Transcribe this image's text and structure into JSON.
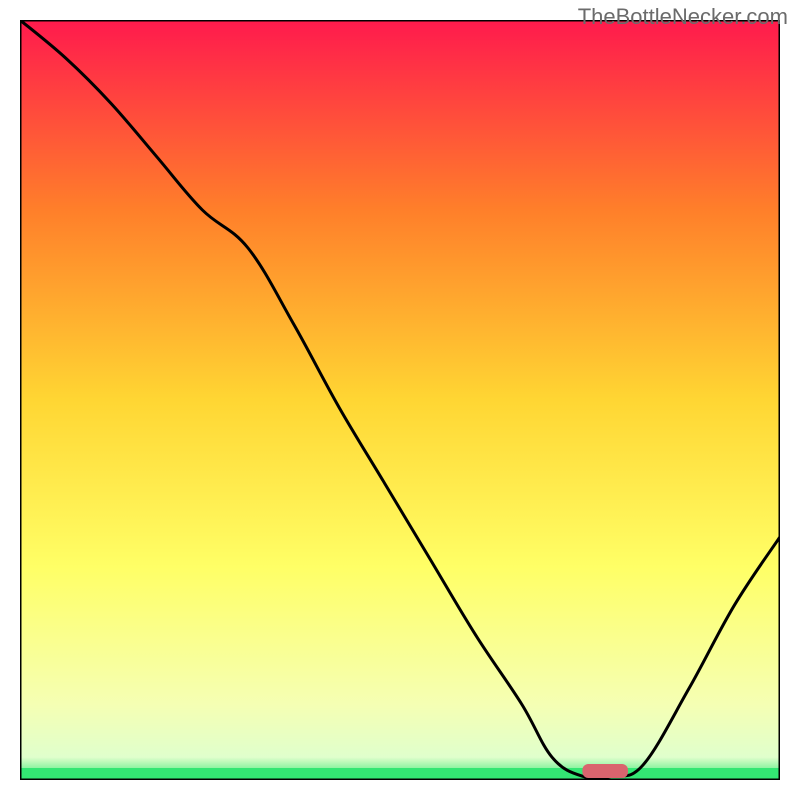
{
  "watermark": "TheBottleNecker.com",
  "chart_data": {
    "type": "line",
    "title": "",
    "xlabel": "",
    "ylabel": "",
    "xlim": [
      0,
      100
    ],
    "ylim": [
      0,
      100
    ],
    "background_gradient": {
      "top": "#ff1a4d",
      "upper_mid": "#ff7f2a",
      "mid": "#ffd633",
      "lower_mid": "#ffff66",
      "near_bottom": "#f5ffb3",
      "bottom_band": "#33e673"
    },
    "curve": {
      "comment": "Approximate y values (0=bottom, 100=top) along x from 0..100 tracing the black line",
      "x": [
        0,
        6,
        12,
        18,
        24,
        30,
        36,
        42,
        48,
        54,
        60,
        66,
        70,
        74,
        78,
        82,
        88,
        94,
        100
      ],
      "y": [
        100,
        95,
        89,
        82,
        75,
        70,
        60,
        49,
        39,
        29,
        19,
        10,
        3,
        0.5,
        0.5,
        2,
        12,
        23,
        32
      ]
    },
    "marker": {
      "comment": "Small red rounded bar near the dip on x-axis",
      "x_center": 77,
      "width": 6,
      "color": "#d9646e"
    }
  }
}
